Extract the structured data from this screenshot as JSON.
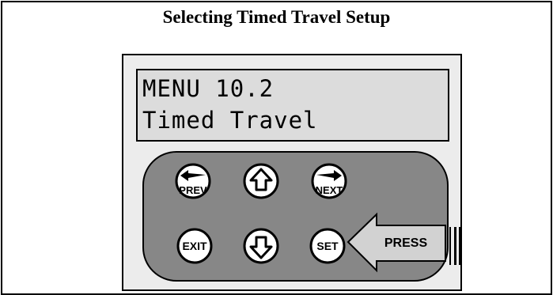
{
  "title": "Selecting Timed Travel Setup",
  "display": {
    "line1": "MENU 10.2",
    "line2": "Timed Travel"
  },
  "keys": {
    "prev": "PREV",
    "up": "up-arrow",
    "next": "NEXT",
    "exit": "EXIT",
    "down": "down-arrow",
    "set": "SET"
  },
  "callout": {
    "label": "PRESS"
  },
  "colors": {
    "keypad": "#878787",
    "arrow": "#d2d2d2",
    "panel": "#ececec",
    "lcd": "#dcdcdc"
  }
}
